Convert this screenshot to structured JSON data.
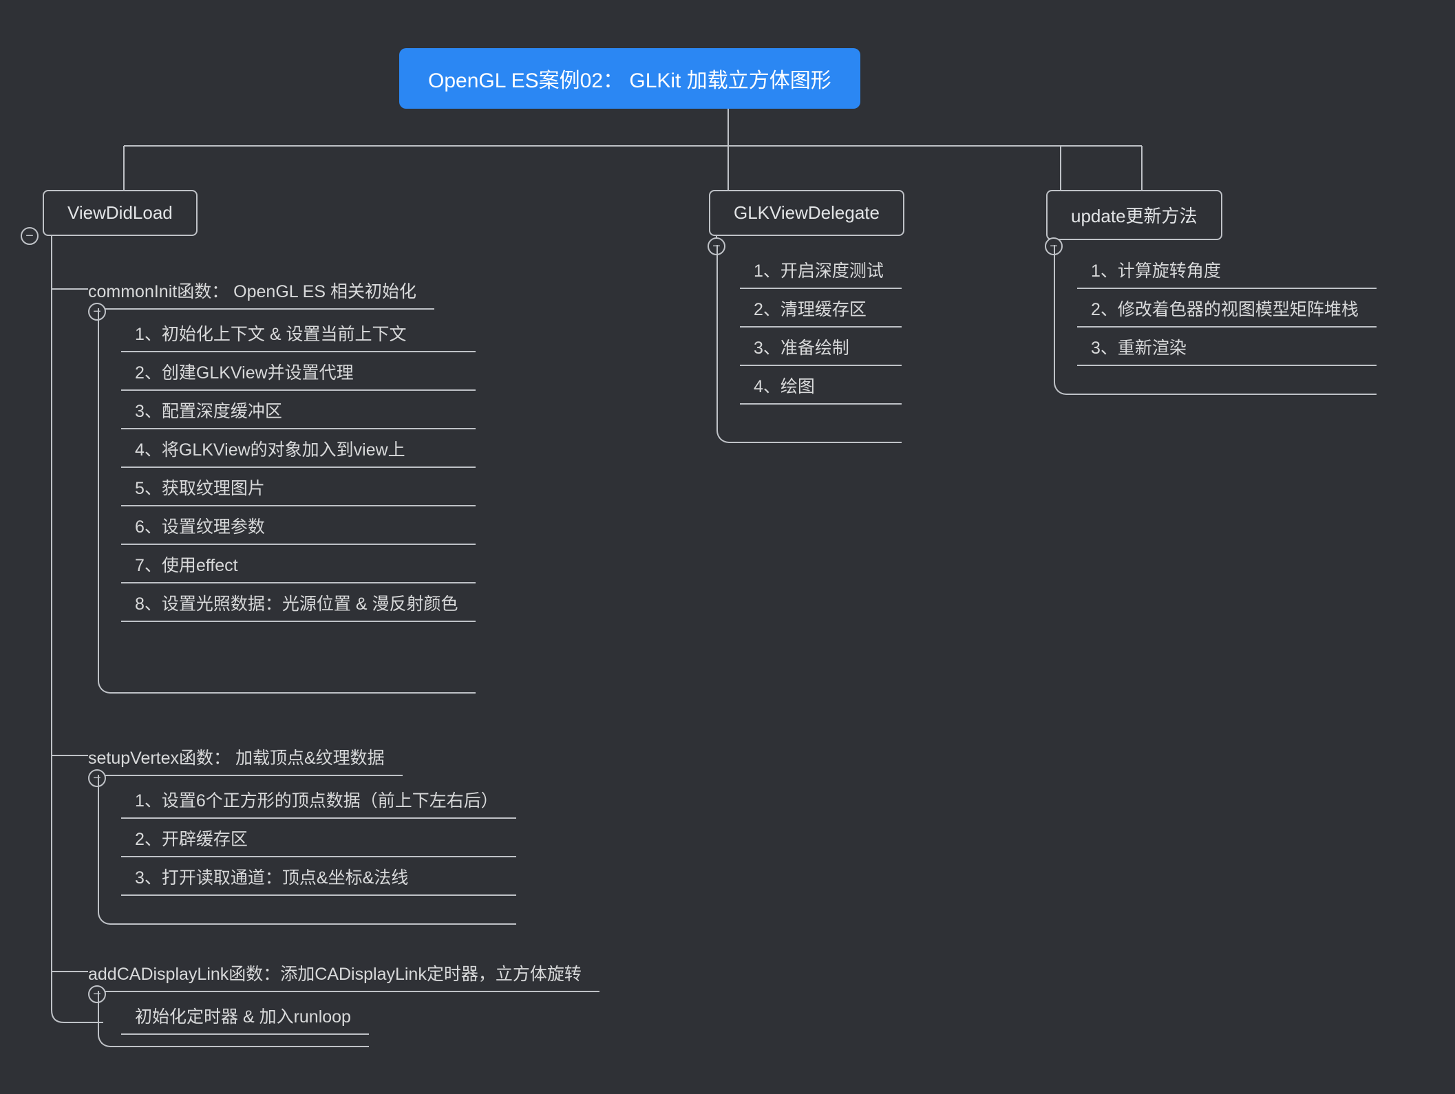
{
  "root": "OpenGL ES案例02： GLKit 加载立方体图形",
  "branches": {
    "viewDidLoad": {
      "title": "ViewDidLoad",
      "sections": {
        "commonInit": {
          "title": "commonInit函数： OpenGL ES 相关初始化",
          "items": [
            "1、初始化上下文 & 设置当前上下文",
            "2、创建GLKView并设置代理",
            "3、配置深度缓冲区",
            "4、将GLKView的对象加入到view上",
            "5、获取纹理图片",
            "6、设置纹理参数",
            "7、使用effect",
            "8、设置光照数据：光源位置 & 漫反射颜色"
          ]
        },
        "setupVertex": {
          "title": "setupVertex函数： 加载顶点&纹理数据",
          "items": [
            "1、设置6个正方形的顶点数据（前上下左右后）",
            "2、开辟缓存区",
            "3、打开读取通道：顶点&坐标&法线"
          ]
        },
        "addCADisplayLink": {
          "title": "addCADisplayLink函数：添加CADisplayLink定时器，立方体旋转",
          "items": [
            "初始化定时器 & 加入runloop"
          ]
        }
      }
    },
    "glkViewDelegate": {
      "title": "GLKViewDelegate",
      "items": [
        "1、开启深度测试",
        "2、清理缓存区",
        "3、准备绘制",
        "4、绘图"
      ]
    },
    "update": {
      "title": "update更新方法",
      "items": [
        "1、计算旋转角度",
        "2、修改着色器的视图模型矩阵堆栈",
        "3、重新渲染"
      ]
    }
  }
}
